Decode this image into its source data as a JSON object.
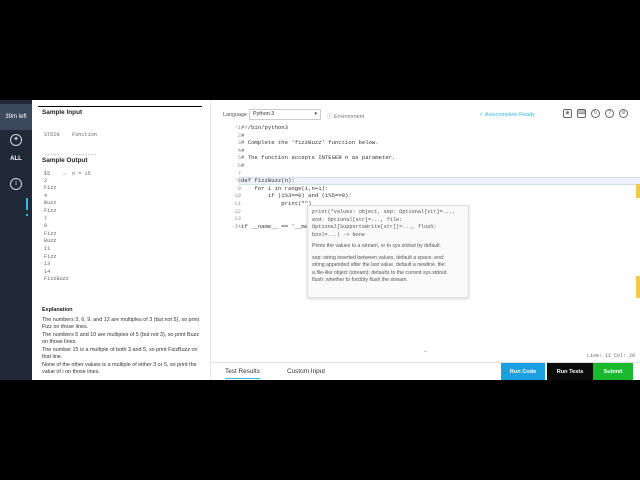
{
  "rail": {
    "timer": "39m left",
    "all_label": "ALL"
  },
  "problem": {
    "sample_input_title": "Sample Input",
    "sample_input_lines": [
      "STDIN    Function",
      "-----    --------",
      "15    →  n = 15"
    ],
    "sample_output_title": "Sample Output",
    "sample_output_lines": [
      "1",
      "2",
      "Fizz",
      "4",
      "Buzz",
      "Fizz",
      "7",
      "8",
      "Fizz",
      "Buzz",
      "11",
      "Fizz",
      "13",
      "14",
      "FizzBuzz"
    ],
    "explanation_title": "Explanation",
    "explanation_paragraphs": [
      "The numbers 3, 6, 9, and 12 are multiples of 3 (but not 5), so print Fizz on those lines.",
      "The numbers 5 and 10 are multiples of 5 (but not 3), so print Buzz on those lines.",
      "The number 15 is a multiple of both 3 and 5, so print FizzBuzz on that line.",
      "None of the other values is a multiple of either 3 or 5, so print the value of i on those lines."
    ]
  },
  "toolbar": {
    "language_label": "Language",
    "language_value": "Python 3",
    "environment_label": "Environment",
    "autocomplete_label": "Autocomplete Ready"
  },
  "code": {
    "lines": [
      {
        "n": "1",
        "text": "#!/bin/python3"
      },
      {
        "n": "2",
        "text": "#"
      },
      {
        "n": "3",
        "text": "# Complete the 'fizzBuzz' function below."
      },
      {
        "n": "4",
        "text": "#"
      },
      {
        "n": "5",
        "text": "# The function accepts INTEGER n as parameter."
      },
      {
        "n": "6",
        "text": "#"
      },
      {
        "n": "7",
        "text": ""
      },
      {
        "n": "8",
        "text": "def fizzBuzz(n):"
      },
      {
        "n": "9",
        "text": "    for i in range(1,n+1):"
      },
      {
        "n": "10",
        "text": "        if (i%3==0) and (i%5==0):"
      },
      {
        "n": "11",
        "text": "            print(\"\")"
      },
      {
        "n": "12",
        "text": ""
      },
      {
        "n": "13",
        "text": ""
      },
      {
        "n": "14",
        "text": "if __name__ == '__main__':"
      }
    ]
  },
  "tooltip": {
    "signature": [
      "print(*values: object, sep: Optional[str]=...,",
      "end: Optional[str]=..., file:",
      "Optional[SupportsWrite[str]]=..., flush:",
      "bool=...) -> None"
    ],
    "summary": "Prints the values to a stream, or to sys.stdout by default.",
    "params": [
      "sep:  string inserted between values, default a space. end:",
      "string appended after the last value, default a newline. file:",
      "a file-like object (stream); defaults to the current sys.stdout.",
      "flush:  whether to forcibly flush the stream."
    ]
  },
  "status": {
    "position": "Line: 11 Col: 20"
  },
  "bottom": {
    "tab_results": "Test Results",
    "tab_custom": "Custom Input",
    "run_code": "Run Code",
    "run_tests": "Run Tests",
    "submit": "Submit"
  },
  "colors": {
    "accent": "#39b6e8",
    "run_code_bg": "#1ba1e2",
    "run_tests_bg": "#0b0b0b",
    "submit_bg": "#19b82d"
  }
}
